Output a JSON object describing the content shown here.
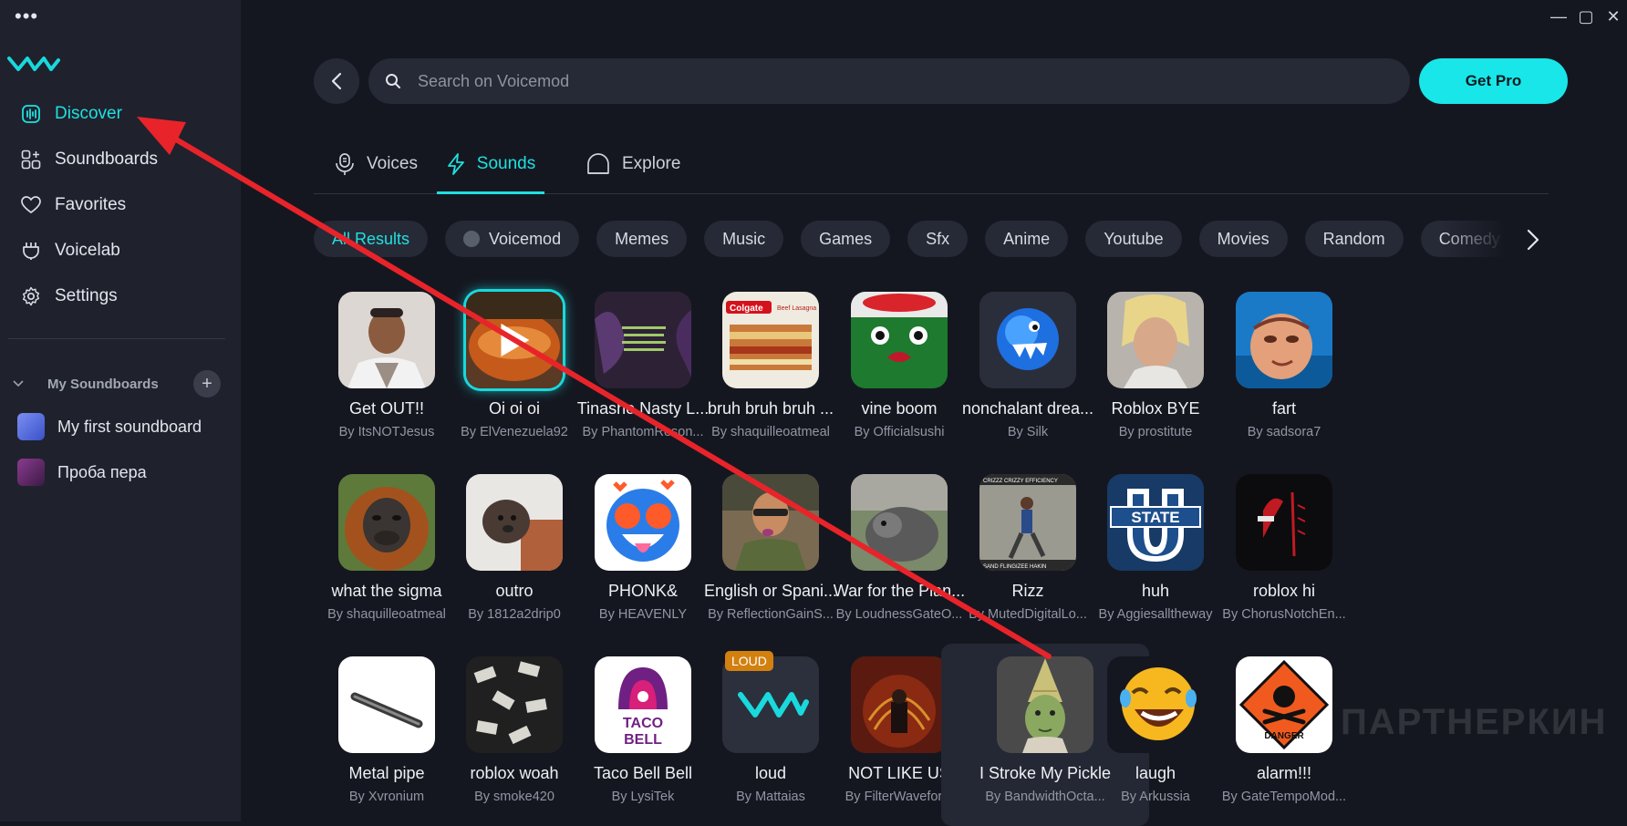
{
  "window": {
    "more_label": "•••",
    "minimize": "—",
    "maximize": "▢",
    "close": "✕"
  },
  "sidebar": {
    "nav": [
      {
        "label": "Discover",
        "icon": "discover-icon",
        "active": true
      },
      {
        "label": "Soundboards",
        "icon": "soundboards-icon"
      },
      {
        "label": "Favorites",
        "icon": "heart-icon"
      },
      {
        "label": "Voicelab",
        "icon": "voicelab-icon"
      },
      {
        "label": "Settings",
        "icon": "gear-icon"
      }
    ],
    "my_soundboards": {
      "label": "My Soundboards",
      "items": [
        {
          "label": "My first soundboard",
          "color": "#5b76e6"
        },
        {
          "label": "Проба пера",
          "color": "#6d2d74"
        }
      ]
    }
  },
  "header": {
    "search_placeholder": "Search on Voicemod",
    "get_pro": "Get Pro"
  },
  "tabs": [
    {
      "label": "Voices",
      "icon": "microphone-icon"
    },
    {
      "label": "Sounds",
      "icon": "lightning-icon",
      "active": true
    },
    {
      "label": "Explore",
      "icon": "explore-icon"
    }
  ],
  "filters": [
    "All Results",
    "Voicemod",
    "Memes",
    "Music",
    "Games",
    "Sfx",
    "Anime",
    "Youtube",
    "Movies",
    "Random",
    "Comedy"
  ],
  "sounds": [
    [
      {
        "title": "Get OUT!!",
        "author": "By ItsNOTJesus"
      },
      {
        "title": "Oi oi oi",
        "author": "By ElVenezuela92"
      },
      {
        "title": "Tinashe Nasty L...",
        "author": "By PhantomReson..."
      },
      {
        "title": "bruh bruh bruh ...",
        "author": "By shaquilleoatmeal"
      },
      {
        "title": "vine boom",
        "author": "By Officialsushi"
      },
      {
        "title": "nonchalant drea...",
        "author": "By Silk"
      },
      {
        "title": "Roblox BYE",
        "author": "By prostitute"
      },
      {
        "title": "fart",
        "author": "By sadsora7"
      }
    ],
    [
      {
        "title": "what the sigma",
        "author": "By shaquilleoatmeal"
      },
      {
        "title": "outro",
        "author": "By 1812a2drip0"
      },
      {
        "title": "PHONK&",
        "author": "By HEAVENLY"
      },
      {
        "title": "English or Spani...",
        "author": "By ReflectionGainS..."
      },
      {
        "title": "War for the Plan...",
        "author": "By LoudnessGateO..."
      },
      {
        "title": "Rizz",
        "author": "By MutedDigitalLo..."
      },
      {
        "title": "huh",
        "author": "By Aggiesalltheway"
      },
      {
        "title": "roblox hi",
        "author": "By ChorusNotchEn..."
      }
    ],
    [
      {
        "title": "Metal pipe",
        "author": "By Xvronium"
      },
      {
        "title": "roblox woah",
        "author": "By smoke420"
      },
      {
        "title": "Taco Bell Bell",
        "author": "By LysiTek"
      },
      {
        "title": "loud",
        "author": "By Mattaias",
        "badge": "LOUD"
      },
      {
        "title": "NOT LIKE US",
        "author": "By FilterWaveform"
      },
      {
        "title": "I Stroke My Pickle",
        "author": "By BandwidthOcta..."
      },
      {
        "title": "laugh",
        "author": "By Arkussia"
      },
      {
        "title": "alarm!!!",
        "author": "By GateTempoMod..."
      }
    ]
  ],
  "thumb_text": {
    "colgate": "Colgate",
    "beef": "Beef Lasagna",
    "state": "STATE",
    "taco": "TACO",
    "bell": "BELL",
    "danger": "DANGER",
    "rizz_top": "CRIZZZ CRIZZY EFFICIENCY",
    "rizz_bottom": "SAND  FLINGIZEE HAKIN"
  },
  "watermark": "ПАРТНЕРКИН",
  "colors": {
    "accent": "#1fe0e0",
    "annotation": "#e8242a",
    "background": "#151720",
    "sidebar": "#1f222d"
  }
}
